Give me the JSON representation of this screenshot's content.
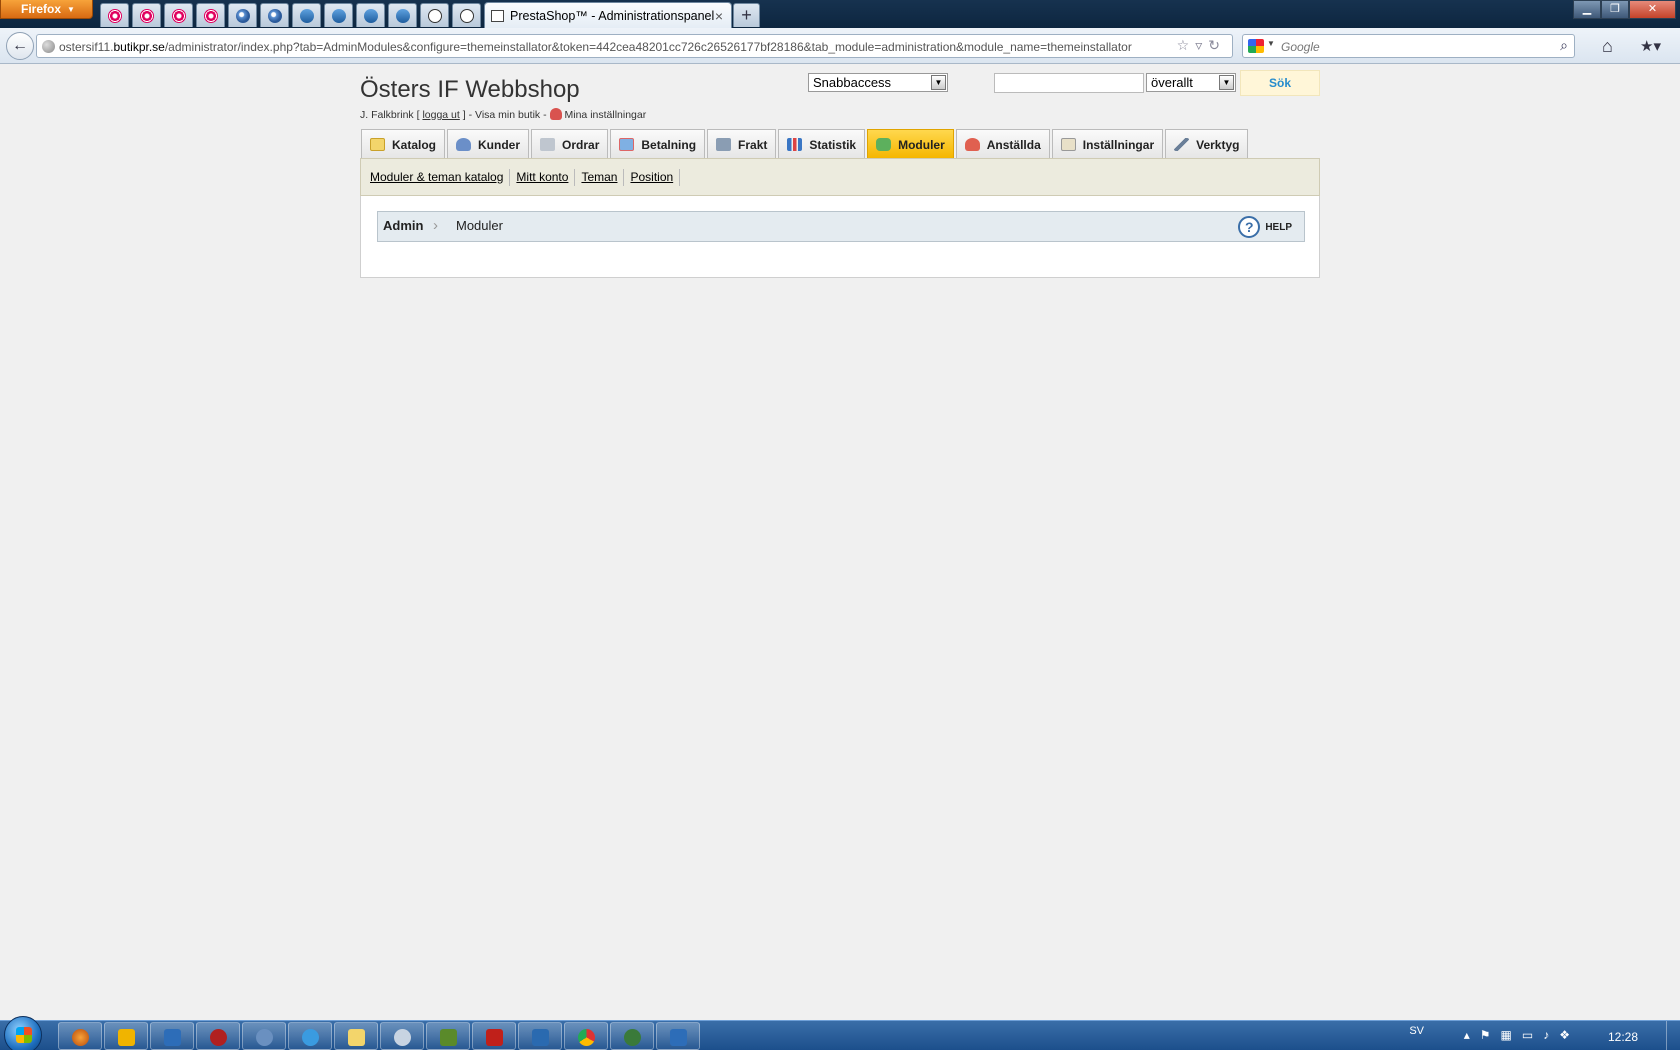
{
  "browser": {
    "menu_button": "Firefox",
    "app_tabs": [
      {
        "icon": "opera-icon"
      },
      {
        "icon": "opera-icon"
      },
      {
        "icon": "opera-icon"
      },
      {
        "icon": "opera-icon"
      },
      {
        "icon": "globe-icon"
      },
      {
        "icon": "globe-icon"
      },
      {
        "icon": "speaker-icon"
      },
      {
        "icon": "speaker-icon"
      },
      {
        "icon": "speaker-icon"
      },
      {
        "icon": "speaker-icon"
      },
      {
        "icon": "prestashop-icon"
      },
      {
        "icon": "prestashop-icon"
      }
    ],
    "active_tab_title": "PrestaShop™ - Administrationspanel",
    "url_host_prefix": "ostersif11.",
    "url_host": "butikpr.se",
    "url_path": "/administrator/index.php?tab=AdminModules&configure=themeinstallator&token=442cea48201cc726c26526177bf28186&tab_module=administration&module_name=themeinstallator",
    "search_placeholder": "Google"
  },
  "header": {
    "shop_title": "Östers IF Webbshop",
    "user_name": "J. Falkbrink",
    "logout_label": "logga ut",
    "view_shop_label": "Visa min butik",
    "settings_label": "Mina inställningar",
    "quick_access": "Snabbaccess",
    "search_value": "",
    "search_scope": "överallt",
    "search_button": "Sök"
  },
  "tabs": [
    {
      "label": "Katalog",
      "icon": "folder-icon",
      "active": false
    },
    {
      "label": "Kunder",
      "icon": "customer-icon",
      "active": false
    },
    {
      "label": "Ordrar",
      "icon": "cart-icon",
      "active": false
    },
    {
      "label": "Betalning",
      "icon": "payment-icon",
      "active": false
    },
    {
      "label": "Frakt",
      "icon": "truck-icon",
      "active": false
    },
    {
      "label": "Statistik",
      "icon": "chart-icon",
      "active": false
    },
    {
      "label": "Moduler",
      "icon": "puzzle-icon",
      "active": true
    },
    {
      "label": "Anställda",
      "icon": "employee-icon",
      "active": false
    },
    {
      "label": "Inställningar",
      "icon": "settings-icon",
      "active": false
    },
    {
      "label": "Verktyg",
      "icon": "wrench-icon",
      "active": false
    }
  ],
  "subnav": [
    {
      "label": "Moduler & teman katalog"
    },
    {
      "label": "Mitt konto"
    },
    {
      "label": "Teman"
    },
    {
      "label": "Position"
    }
  ],
  "breadcrumb": {
    "root": "Admin",
    "current": "Moduler",
    "help_label": "HELP"
  },
  "taskbar": {
    "language": "SV",
    "clock": "12:28"
  },
  "colors": {
    "active_tab": "#f5b600",
    "search_button_text": "#268ccd",
    "subnav_bg": "#ecebde",
    "breadcrumb_bg": "#e4ebf0"
  }
}
